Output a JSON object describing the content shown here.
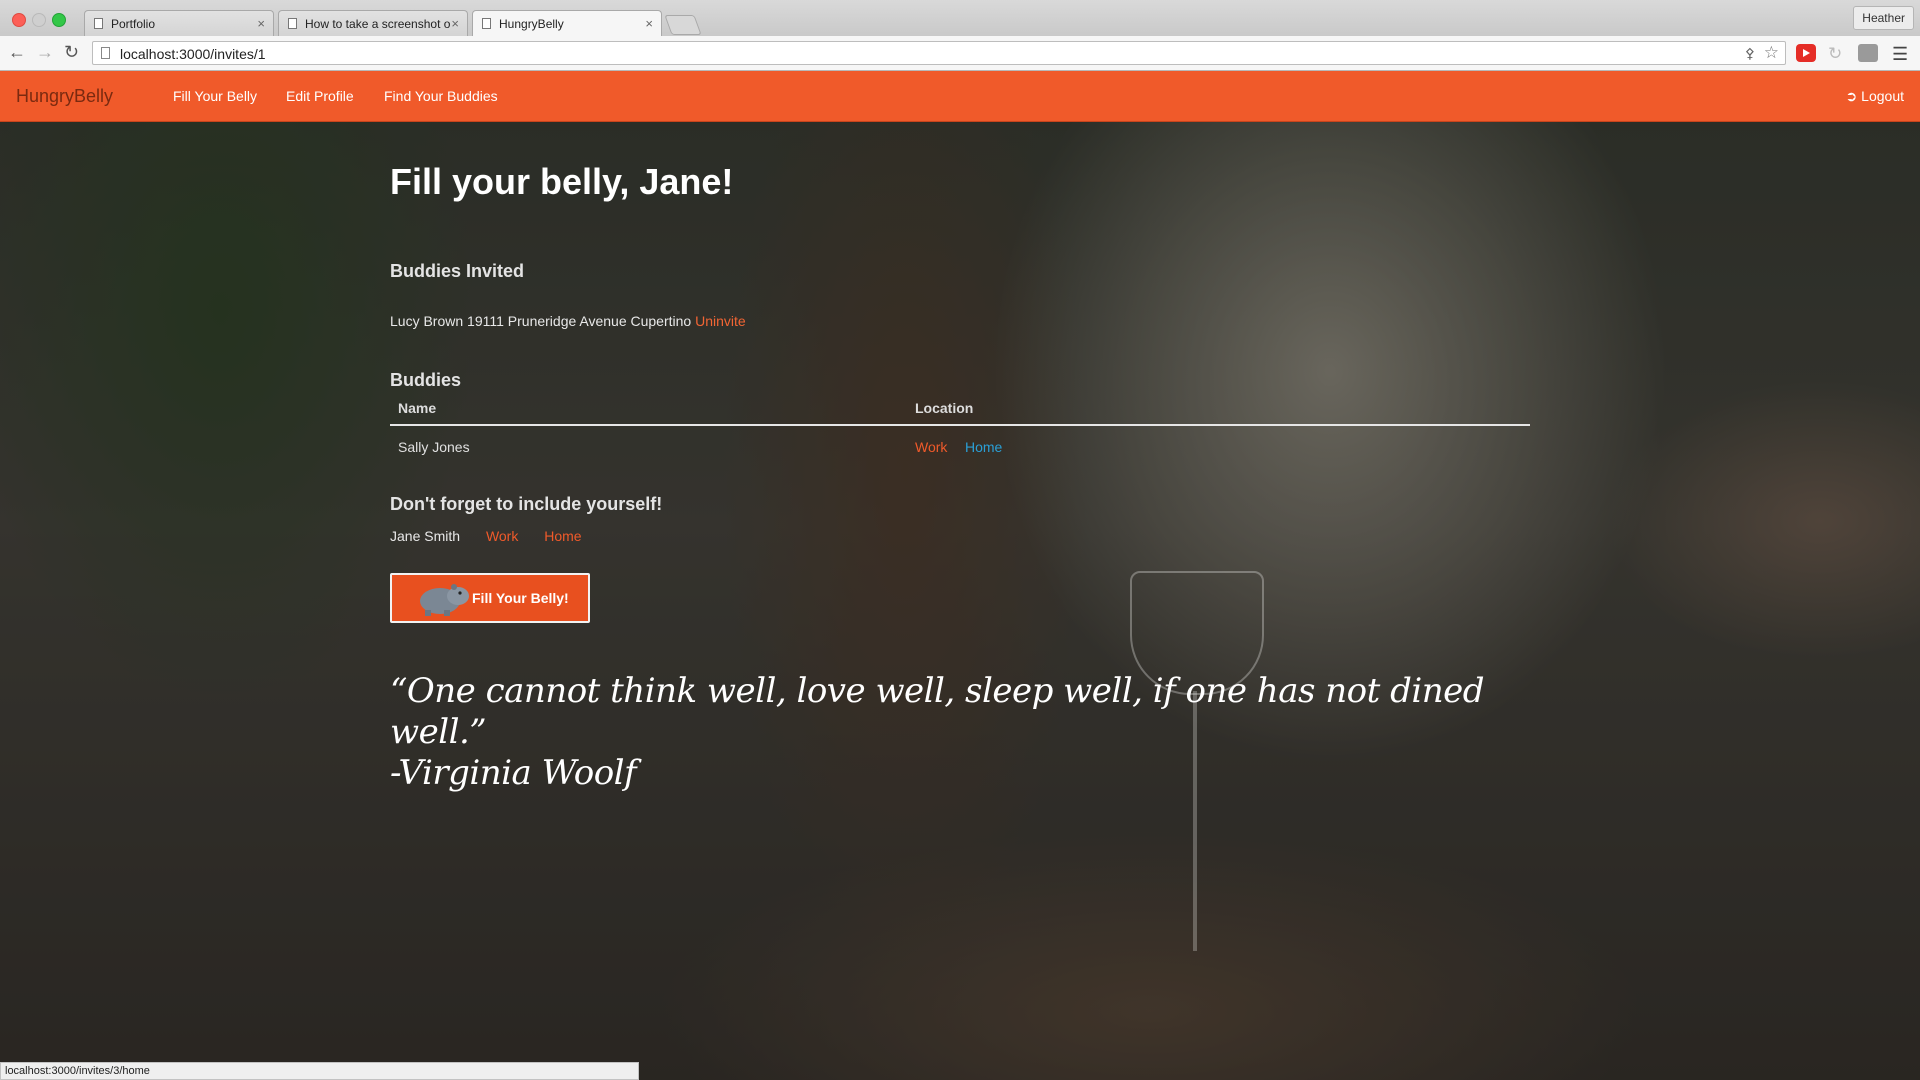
{
  "browser": {
    "tabs": [
      {
        "label": "Portfolio",
        "active": false
      },
      {
        "label": "How to take a screenshot o",
        "active": false
      },
      {
        "label": "HungryBelly",
        "active": true
      }
    ],
    "profile_name": "Heather",
    "url": "localhost:3000/invites/1",
    "status_url": "localhost:3000/invites/3/home"
  },
  "nav": {
    "brand": "HungryBelly",
    "links": [
      "Fill Your Belly",
      "Edit Profile",
      "Find Your Buddies"
    ],
    "logout_label": "Logout"
  },
  "main": {
    "title": "Fill your belly, Jane!",
    "invited_heading": "Buddies Invited",
    "invited": [
      {
        "text": "Lucy Brown 19111 Pruneridge Avenue Cupertino",
        "action": "Uninvite"
      }
    ],
    "buddies_heading": "Buddies",
    "columns": [
      "Name",
      "Location"
    ],
    "rows": [
      {
        "name": "Sally Jones",
        "work": "Work",
        "home": "Home"
      }
    ],
    "self_heading": "Don't forget to include yourself!",
    "self": {
      "name": "Jane Smith",
      "work": "Work",
      "home": "Home"
    },
    "button_label": "Fill Your Belly!",
    "quote_line1": "“One cannot think well, love well, sleep well, if one has not dined well.”",
    "quote_line2": "-Virginia Woolf"
  },
  "colors": {
    "accent": "#f05a2a",
    "link_blue": "#2a9fd6"
  },
  "icons": [
    "close-icon",
    "back-icon",
    "forward-icon",
    "reload-icon",
    "key-icon",
    "star-icon",
    "menu-icon",
    "logout-icon",
    "hippo-icon"
  ]
}
